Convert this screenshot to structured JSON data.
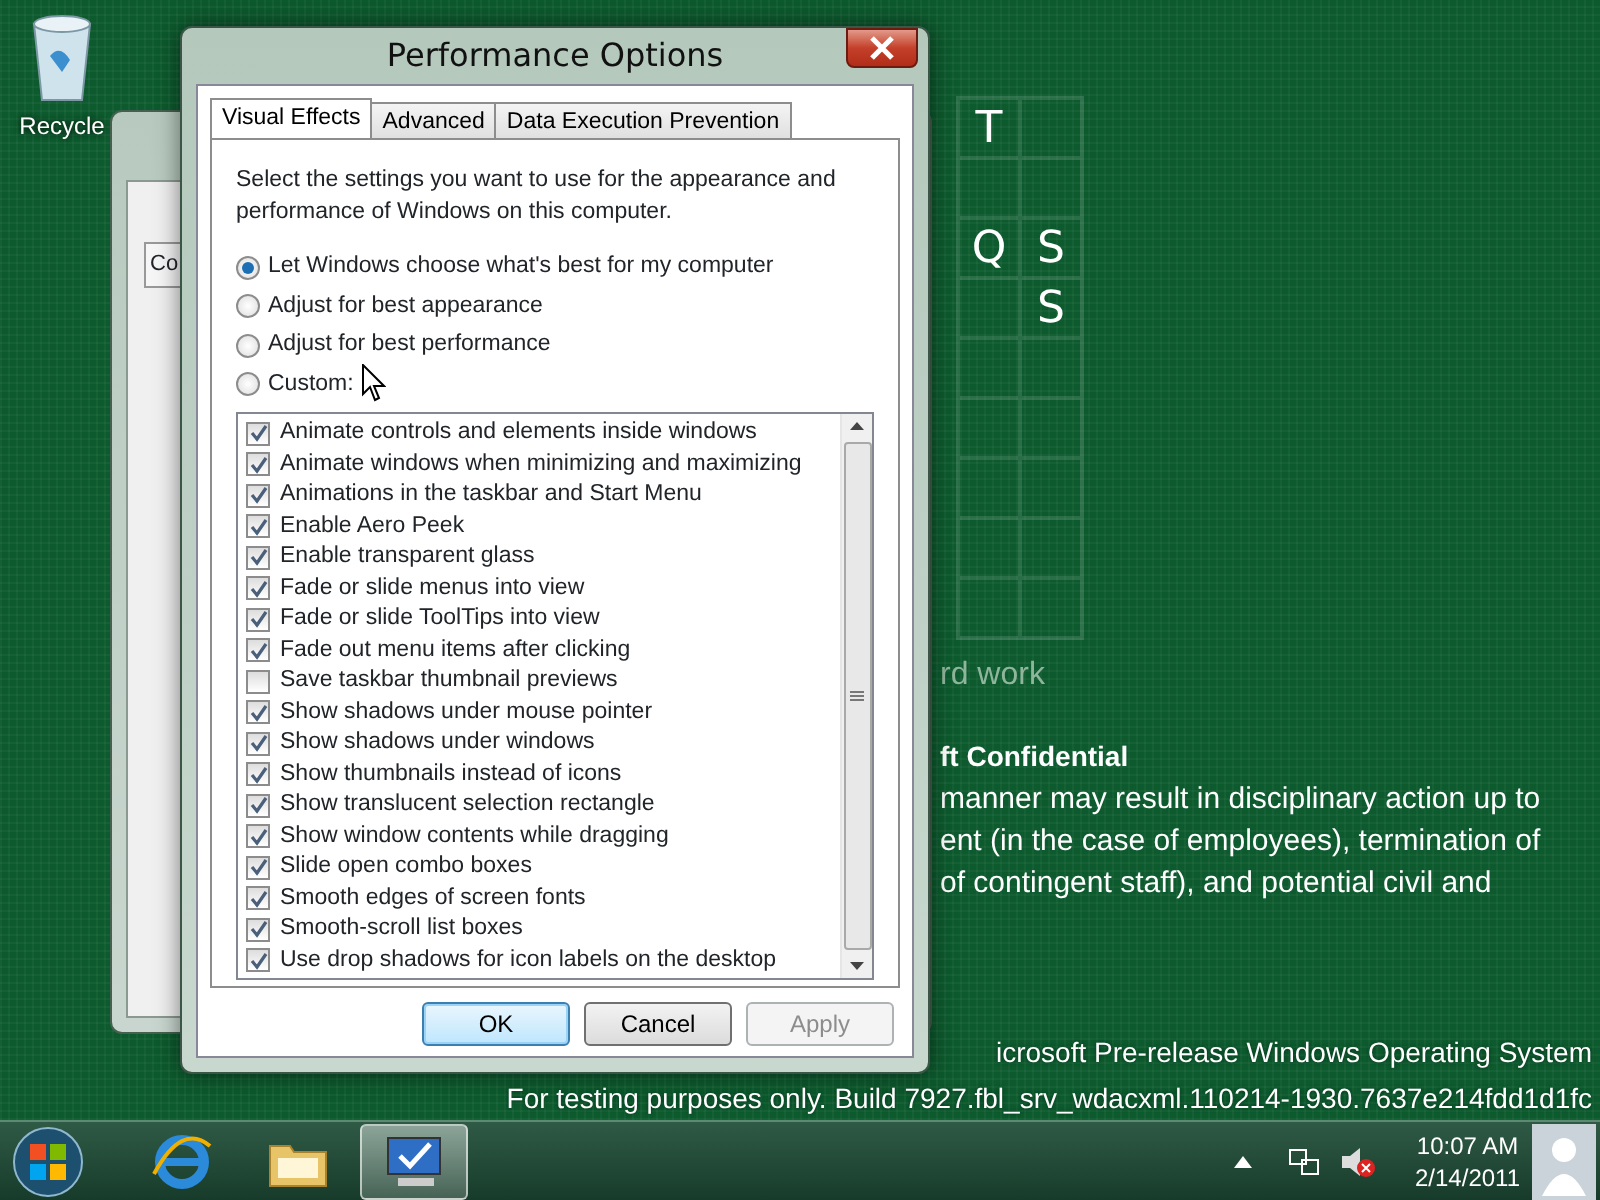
{
  "desktop": {
    "recycle_bin": {
      "label": "Recycle"
    },
    "grid_rows": [
      [
        "T",
        null
      ],
      [
        null,
        null
      ],
      [
        "Q",
        "S"
      ],
      [
        null,
        "S"
      ],
      [
        null,
        null
      ],
      [
        null,
        null
      ],
      [
        null,
        null
      ],
      [
        null,
        null
      ],
      [
        null,
        null
      ]
    ],
    "background_text": {
      "heading_fragment": "rd work",
      "title_fragment": "ft Confidential",
      "lines": [
        "manner may result in disciplinary action up to",
        "ent (in the case of employees), termination of",
        "of contingent staff), and potential civil and"
      ]
    },
    "build_watermark": [
      "icrosoft Pre-release Windows Operating System",
      "For testing purposes only. Build 7927.fbl_srv_wdacxml.110214-1930.7637e214fdd1d1fc"
    ]
  },
  "back_window": {
    "tab": "Co"
  },
  "dialog": {
    "title": "Performance Options",
    "tabs": [
      {
        "label": "Visual Effects",
        "selected": true
      },
      {
        "label": "Advanced",
        "selected": false
      },
      {
        "label": "Data Execution Prevention",
        "selected": false
      }
    ],
    "description": "Select the settings you want to use for the appearance and performance of Windows on this computer.",
    "options": [
      {
        "label": "Let Windows choose what's best for my computer",
        "selected": true
      },
      {
        "label": "Adjust for best appearance",
        "selected": false
      },
      {
        "label": "Adjust for best performance",
        "selected": false
      },
      {
        "label": "Custom:",
        "selected": false
      }
    ],
    "effects": [
      {
        "label": "Animate controls and elements inside windows",
        "checked": true
      },
      {
        "label": "Animate windows when minimizing and maximizing",
        "checked": true
      },
      {
        "label": "Animations in the taskbar and Start Menu",
        "checked": true
      },
      {
        "label": "Enable Aero Peek",
        "checked": true
      },
      {
        "label": "Enable transparent glass",
        "checked": true
      },
      {
        "label": "Fade or slide menus into view",
        "checked": true
      },
      {
        "label": "Fade or slide ToolTips into view",
        "checked": true
      },
      {
        "label": "Fade out menu items after clicking",
        "checked": true
      },
      {
        "label": "Save taskbar thumbnail previews",
        "checked": false
      },
      {
        "label": "Show shadows under mouse pointer",
        "checked": true
      },
      {
        "label": "Show shadows under windows",
        "checked": true
      },
      {
        "label": "Show thumbnails instead of icons",
        "checked": true
      },
      {
        "label": "Show translucent selection rectangle",
        "checked": true
      },
      {
        "label": "Show window contents while dragging",
        "checked": true
      },
      {
        "label": "Slide open combo boxes",
        "checked": true
      },
      {
        "label": "Smooth edges of screen fonts",
        "checked": true
      },
      {
        "label": "Smooth-scroll list boxes",
        "checked": true
      },
      {
        "label": "Use drop shadows for icon labels on the desktop",
        "checked": true
      }
    ],
    "buttons": [
      {
        "label": "OK",
        "default": true,
        "disabled": false
      },
      {
        "label": "Cancel",
        "default": false,
        "disabled": false
      },
      {
        "label": "Apply",
        "default": false,
        "disabled": true
      }
    ]
  },
  "taskbar": {
    "apps": [
      {
        "kind": "browser",
        "active": false
      },
      {
        "kind": "folder",
        "active": false
      },
      {
        "kind": "system",
        "active": true
      }
    ],
    "clock": {
      "time": "10:07 AM",
      "date": "2/14/2011"
    }
  }
}
